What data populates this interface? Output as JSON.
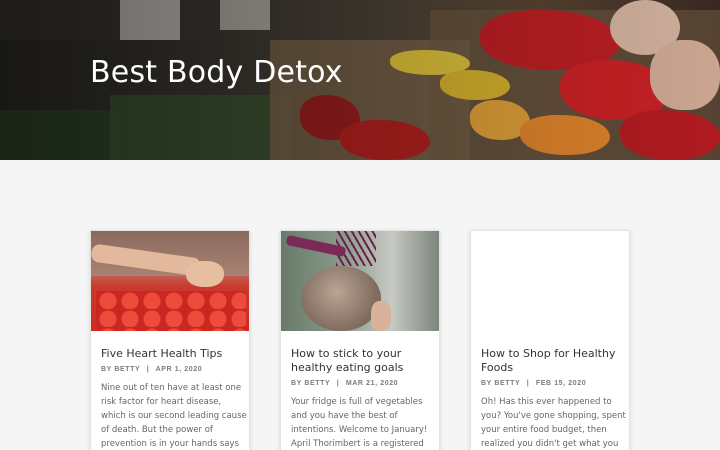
{
  "hero": {
    "title": "Best Body Detox"
  },
  "posts": [
    {
      "title": "Five Heart Health Tips",
      "author_prefix": "BY",
      "author": "BETTY",
      "date": "APR 1, 2020",
      "excerpt": "Nine out of ten have at least one risk factor for heart disease, which is our second leading cause of death. But the power of prevention is in your hands says Registered Dietitian"
    },
    {
      "title": "How to stick to your healthy eating goals",
      "author_prefix": "BY",
      "author": "BETTY",
      "date": "MAR 21, 2020",
      "excerpt": "Your fridge is full of vegetables and you have the best of intentions. Welcome to January! April Thorimbert is a registered dietitian"
    },
    {
      "title": "How to Shop for Healthy Foods",
      "author_prefix": "BY",
      "author": "BETTY",
      "date": "FEB 15, 2020",
      "excerpt": "Oh! Has this ever happened to you? You've gone shopping, spent your entire food budget, then realized you didn't get what you needed to make"
    }
  ]
}
